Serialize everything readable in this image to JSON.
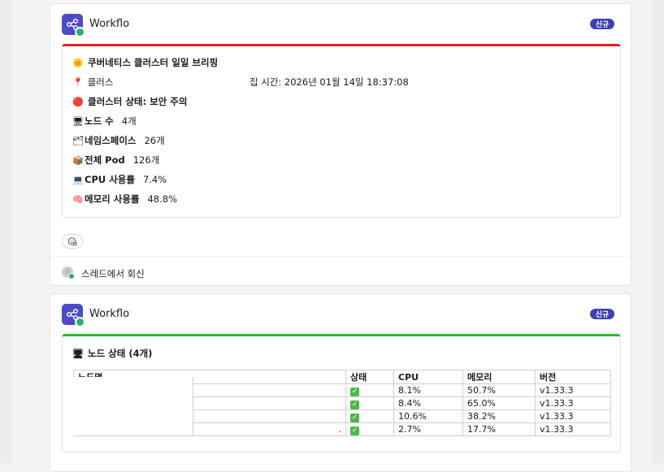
{
  "messages": [
    {
      "app_name": "Workflows",
      "badge": "신규",
      "accent_color": "#e01e1e",
      "lines": [
        {
          "icon": "🌞",
          "label": "쿠버네티스 클러스터 일일 브리핑",
          "value": ""
        },
        {
          "icon": "📍",
          "label": "클러스터: c",
          "value": "집 시간: 2026년 01월 14일 18:37:08"
        },
        {
          "icon": "🔴",
          "label": "클러스터 상태: 보안 주의",
          "value": ""
        },
        {
          "icon": "🖥",
          "label": "노드 수",
          "value": "4개"
        },
        {
          "icon": "🗂",
          "label": "네임스페이스",
          "value": "26개"
        },
        {
          "icon": "📦",
          "label": "전체 Pod",
          "value": "126개"
        },
        {
          "icon": "💻",
          "label": "CPU 사용률",
          "value": "7.4%"
        },
        {
          "icon": "🧠",
          "label": "메모리 사용률",
          "value": "48.8%"
        }
      ],
      "reaction_icon": "add-reaction-icon",
      "thread": {
        "label": "스레드에서 회신"
      }
    },
    {
      "app_name": "Workflows",
      "badge": "신규",
      "accent_color": "#2eb82e",
      "title": {
        "icon": "🖥",
        "text": "노드 상태 (4개)"
      },
      "table": {
        "headers": [
          "노드명",
          "상태",
          "CPU",
          "메모리",
          "버전"
        ],
        "rows": [
          {
            "name": "",
            "status": "✓",
            "cpu": "8.1%",
            "memory": "50.7%",
            "version": "v1.33.3"
          },
          {
            "name": "",
            "status": "✓",
            "cpu": "8.4%",
            "memory": "65.0%",
            "version": "v1.33.3"
          },
          {
            "name": "",
            "status": "✓",
            "cpu": "10.6%",
            "memory": "38.2%",
            "version": "v1.33.3"
          },
          {
            "name": ".",
            "status": "✓",
            "cpu": "2.7%",
            "memory": "17.7%",
            "version": "v1.33.3"
          }
        ]
      }
    }
  ]
}
